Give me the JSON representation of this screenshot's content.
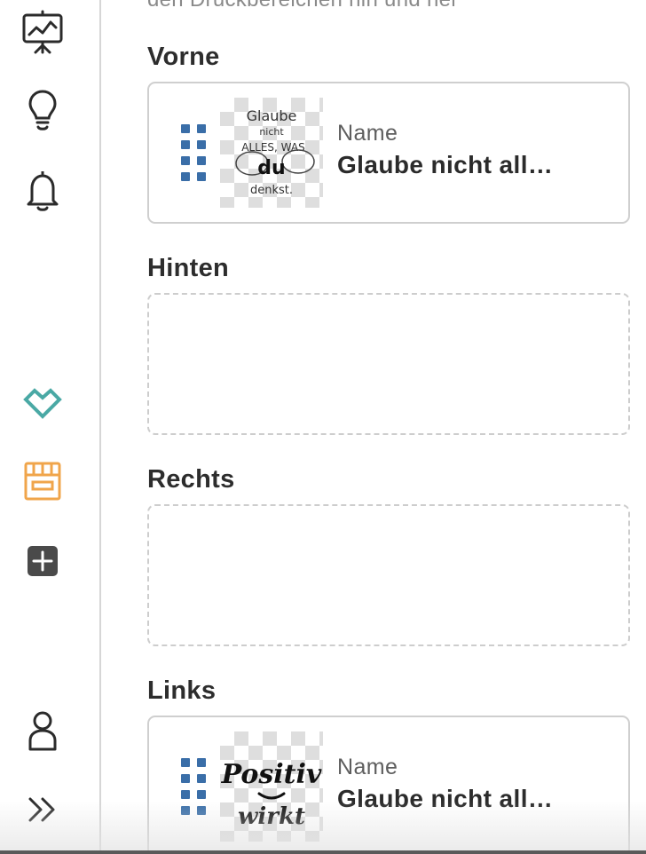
{
  "sidebar": {
    "icons": [
      "presentation-chart-icon",
      "lightbulb-icon",
      "bell-icon",
      "heart-outline-icon",
      "shop-icon",
      "add-square-icon",
      "user-icon",
      "expand-chevrons-icon"
    ],
    "accent_teal": "#4aa9a5",
    "accent_orange": "#f0a54b"
  },
  "main": {
    "top_hint": "den Druckbereichen hin und her",
    "sections": [
      {
        "title": "Vorne",
        "state": "filled",
        "label": "Name",
        "name": "Glaube nicht all…",
        "thumb_text": [
          "Glaube",
          "nicht",
          "ALLES, WAS",
          "du",
          "denkst."
        ]
      },
      {
        "title": "Hinten",
        "state": "empty"
      },
      {
        "title": "Rechts",
        "state": "empty"
      },
      {
        "title": "Links",
        "state": "filled",
        "label": "Name",
        "name": "Glaube nicht all…",
        "thumb_text": [
          "Positiv",
          "wirkt"
        ]
      }
    ],
    "handle_color": "#3a6ea8"
  }
}
